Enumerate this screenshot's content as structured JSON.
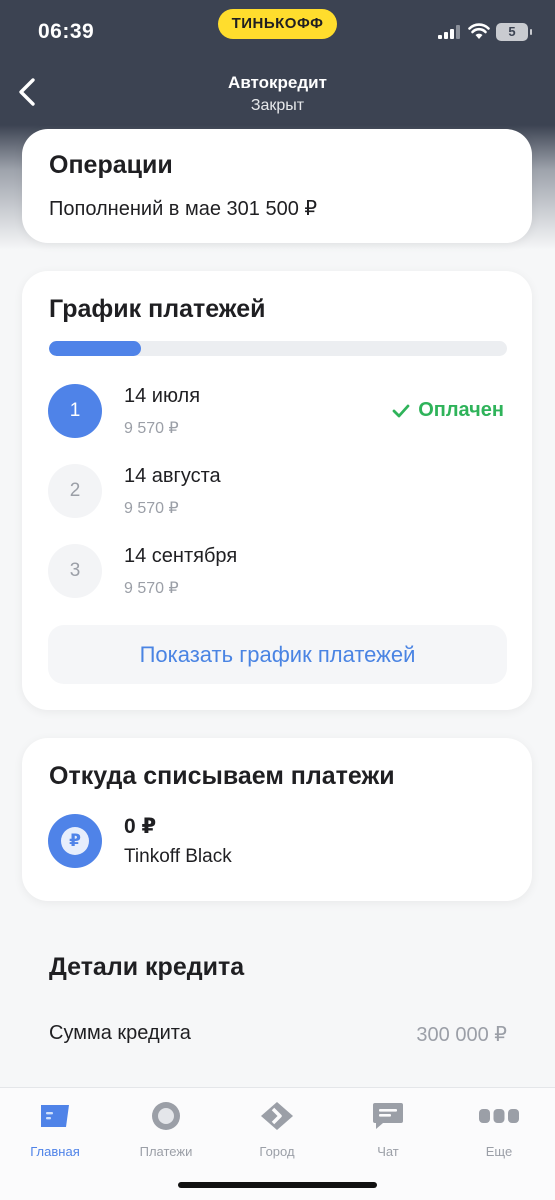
{
  "status_bar": {
    "time": "06:39",
    "brand": "ТИНЬКОФФ",
    "battery": "5"
  },
  "header": {
    "title": "Автокредит",
    "subtitle": "Закрыт"
  },
  "operations": {
    "title": "Операции",
    "text": "Пополнений в мае 301 500 ₽"
  },
  "schedule": {
    "title": "График платежей",
    "progress_fraction": 0.2,
    "payments": [
      {
        "number": "1",
        "date": "14 июля",
        "amount": "9 570 ₽",
        "status": "Оплачен"
      },
      {
        "number": "2",
        "date": "14 августа",
        "amount": "9 570 ₽",
        "status": ""
      },
      {
        "number": "3",
        "date": "14 сентября",
        "amount": "9 570 ₽",
        "status": ""
      }
    ],
    "show_button": "Показать график платежей"
  },
  "source": {
    "title": "Откуда списываем платежи",
    "icon_glyph": "₽",
    "balance": "0 ₽",
    "name": "Tinkoff Black"
  },
  "details": {
    "title": "Детали кредита",
    "rows": [
      {
        "label": "Сумма кредита",
        "value": "300 000 ₽"
      }
    ]
  },
  "tabs": [
    {
      "label": "Главная",
      "icon": "home-card-icon",
      "active": true
    },
    {
      "label": "Платежи",
      "icon": "payments-circle-icon",
      "active": false
    },
    {
      "label": "Город",
      "icon": "city-diamond-icon",
      "active": false
    },
    {
      "label": "Чат",
      "icon": "chat-bubble-icon",
      "active": false
    },
    {
      "label": "Еще",
      "icon": "more-dots-icon",
      "active": false
    }
  ],
  "colors": {
    "accent": "#4f83e8",
    "success": "#2fb35a",
    "brand_yellow": "#ffdd2d",
    "header_bg": "#3c4352"
  }
}
